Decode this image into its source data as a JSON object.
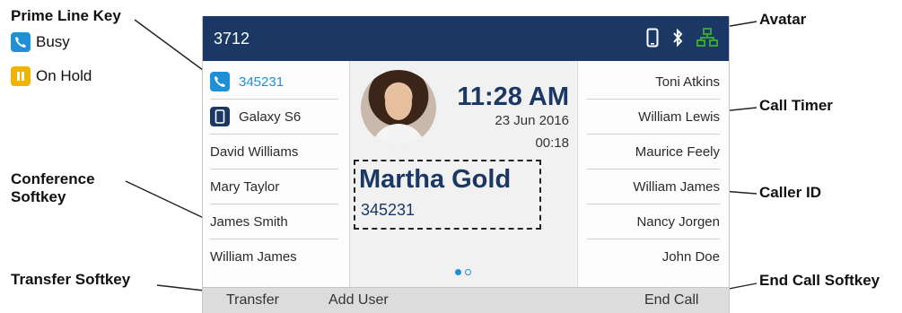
{
  "callouts": {
    "prime_line_key": "Prime Line Key",
    "avatar": "Avatar",
    "call_timer": "Call Timer",
    "conference_softkey_line1": "Conference",
    "conference_softkey_line2": "Softkey",
    "caller_id": "Caller ID",
    "transfer_softkey": "Transfer Softkey",
    "end_call_softkey": "End Call Softkey"
  },
  "legend": [
    {
      "label": "Busy",
      "icon": "phone-busy-icon",
      "color": "#1f8fd6"
    },
    {
      "label": "On Hold",
      "icon": "hold-icon",
      "color": "#f2b200"
    }
  ],
  "screen": {
    "extension": "3712",
    "status_icons": [
      "mobile-icon",
      "bluetooth-icon",
      "network-icon"
    ],
    "left_keys": [
      {
        "label": "345231",
        "icon": "phone-busy-icon",
        "active": true
      },
      {
        "label": "Galaxy S6",
        "icon": "mobile-icon"
      },
      {
        "label": "David Williams"
      },
      {
        "label": "Mary Taylor"
      },
      {
        "label": "James Smith"
      },
      {
        "label": "William James"
      }
    ],
    "right_keys": [
      "Toni Atkins",
      "William Lewis",
      "Maurice Feely",
      "William James",
      "Nancy Jorgen",
      "John Doe"
    ],
    "time": "11:28 AM",
    "date": "23 Jun 2016",
    "call_timer": "00:18",
    "caller_name": "Martha Gold",
    "caller_number": "345231",
    "softkeys": {
      "transfer": "Transfer",
      "add_user": "Add User",
      "end_call": "End Call"
    },
    "colors": {
      "header": "#1b3864",
      "accent": "#1f8fd6",
      "network": "#3aa335"
    }
  }
}
